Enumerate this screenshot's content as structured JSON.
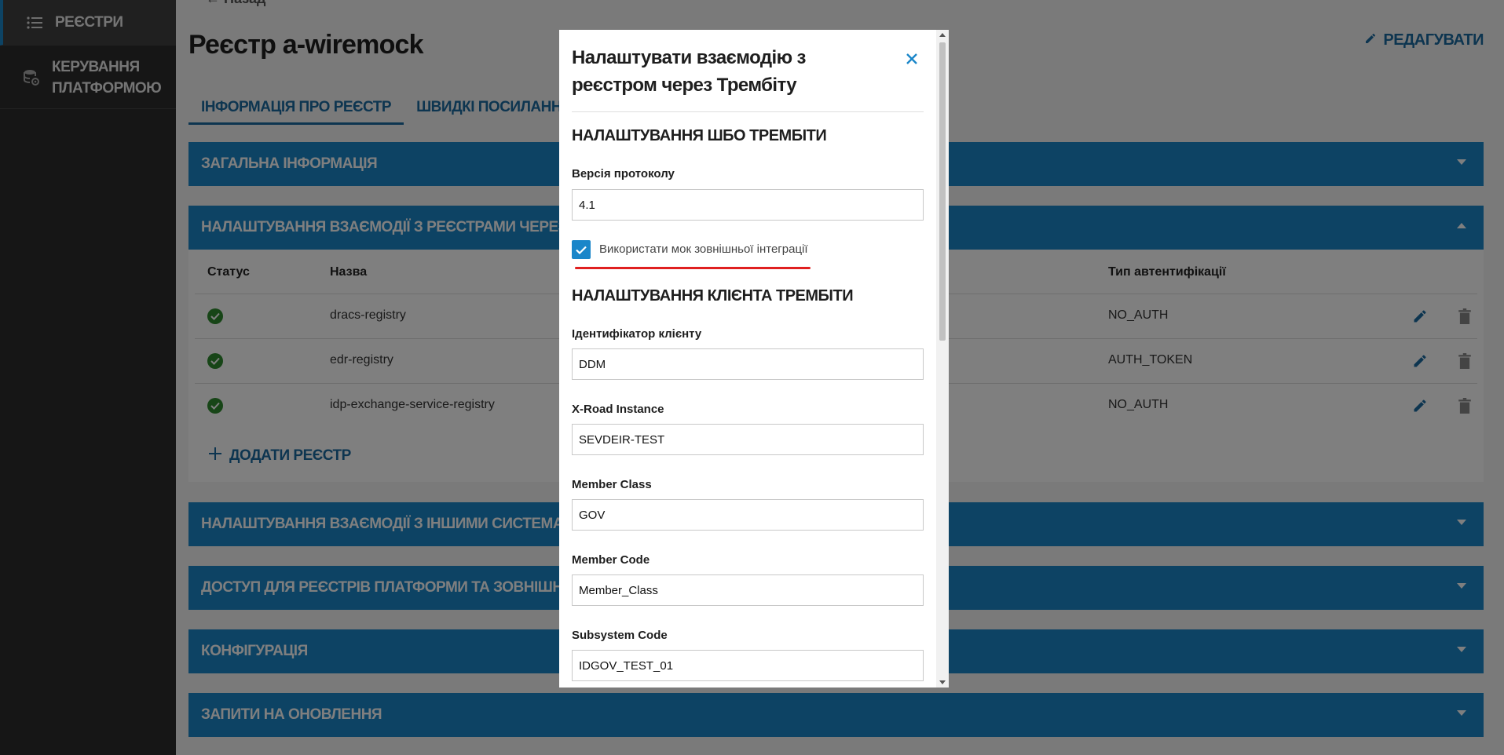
{
  "sidebar": {
    "items": [
      {
        "label": "Реєстри",
        "icon": "list-icon"
      },
      {
        "label": "Керування платформою",
        "icon": "database-settings-icon"
      }
    ]
  },
  "main": {
    "back_label": "Назад",
    "title": "Реєстр a-wiremock",
    "edit_label": "Редагувати",
    "tabs": [
      {
        "label": "Інформація про реєстр",
        "active": true
      },
      {
        "label": "Швидкі посилання",
        "active": false
      }
    ],
    "sections": [
      {
        "label": "Загальна інформація"
      },
      {
        "label": "Налаштування взаємодії з реєстрами через Трембіту"
      },
      {
        "label": "Налаштування взаємодії з іншими системами"
      },
      {
        "label": "Доступ для реєстрів платформи та зовнішніх систем"
      },
      {
        "label": "Конфігурація"
      },
      {
        "label": "Запити на оновлення"
      }
    ],
    "table": {
      "headers": [
        "Статус",
        "Назва",
        "Тип автентифікації"
      ],
      "rows": [
        {
          "name": "dracs-registry",
          "auth": "NO_AUTH"
        },
        {
          "name": "edr-registry",
          "auth": "AUTH_TOKEN"
        },
        {
          "name": "idp-exchange-service-registry",
          "auth": "NO_AUTH"
        }
      ],
      "add_label": "Додати реєстр"
    }
  },
  "modal": {
    "title": "Налаштувати взаємодію з реєстром через Трембіту",
    "section1": "Налаштування ШБО Трембіти",
    "protocol_label": "Версія протоколу",
    "protocol_value": "4.1",
    "checkbox_label": "Використати мок зовнішньої інтеграції",
    "section2": "Налаштування клієнта Трембіти",
    "fields": [
      {
        "label": "Ідентифікатор клієнту",
        "value": "DDM"
      },
      {
        "label": "X-Road Instance",
        "value": "SEVDEIR-TEST"
      },
      {
        "label": "Member Class",
        "value": "GOV"
      },
      {
        "label": "Member Code",
        "value": "Member_Class"
      },
      {
        "label": "Subsystem Code",
        "value": "IDGOV_TEST_01"
      }
    ]
  },
  "colors": {
    "accent": "#1a86c9",
    "sidebar_bg": "#2d2d2d",
    "success": "#2e8b2e",
    "highlight": "#e02020"
  }
}
